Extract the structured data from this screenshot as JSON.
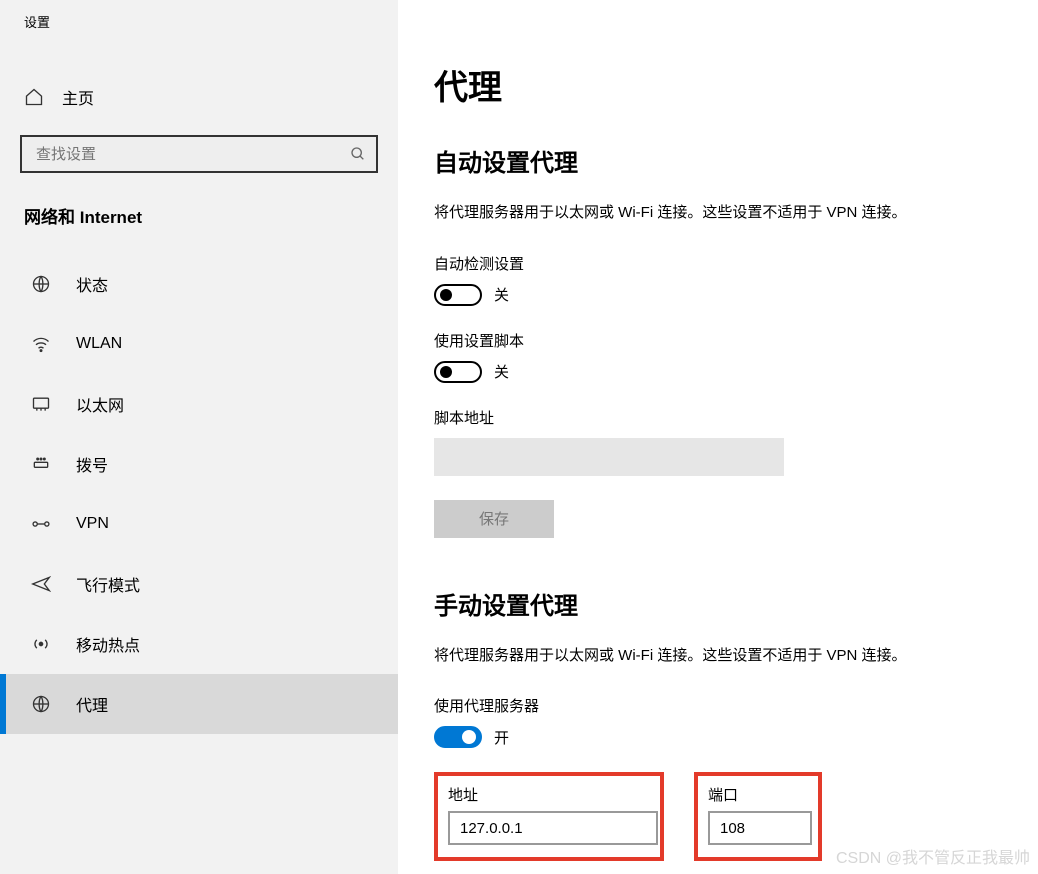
{
  "app_title": "设置",
  "home_label": "主页",
  "search_placeholder": "查找设置",
  "category_heading": "网络和 Internet",
  "nav": [
    {
      "key": "status",
      "label": "状态"
    },
    {
      "key": "wlan",
      "label": "WLAN"
    },
    {
      "key": "ethernet",
      "label": "以太网"
    },
    {
      "key": "dialup",
      "label": "拨号"
    },
    {
      "key": "vpn",
      "label": "VPN"
    },
    {
      "key": "airplane",
      "label": "飞行模式"
    },
    {
      "key": "hotspot",
      "label": "移动热点"
    },
    {
      "key": "proxy",
      "label": "代理"
    }
  ],
  "page_title": "代理",
  "auto": {
    "section_title": "自动设置代理",
    "description": "将代理服务器用于以太网或 Wi-Fi 连接。这些设置不适用于 VPN 连接。",
    "auto_detect_label": "自动检测设置",
    "auto_detect_state": "关",
    "script_label": "使用设置脚本",
    "script_state": "关",
    "script_address_label": "脚本地址",
    "script_address_value": "",
    "save_label": "保存"
  },
  "manual": {
    "section_title": "手动设置代理",
    "description": "将代理服务器用于以太网或 Wi-Fi 连接。这些设置不适用于 VPN 连接。",
    "use_proxy_label": "使用代理服务器",
    "use_proxy_state": "开",
    "address_label": "地址",
    "address_value": "127.0.0.1",
    "port_label": "端口",
    "port_value": "108"
  },
  "watermark": "CSDN @我不管反正我最帅"
}
